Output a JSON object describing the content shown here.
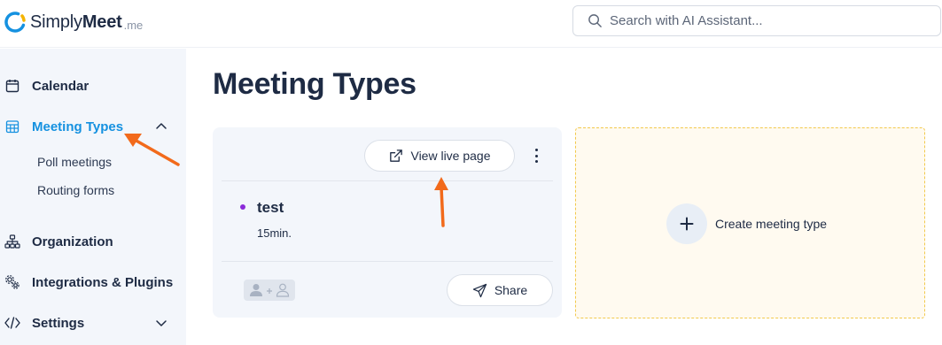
{
  "app": {
    "logo_simply": "Simply",
    "logo_meet": "Meet",
    "logo_tld": ".me",
    "brand_color": "#1591e0"
  },
  "search": {
    "placeholder": "Search with AI Assistant..."
  },
  "sidebar": {
    "items": [
      {
        "label": "Calendar",
        "icon": "calendar-icon"
      },
      {
        "label": "Meeting Types",
        "icon": "grid-calendar-icon",
        "active": true,
        "expanded": true
      },
      {
        "label": "Organization",
        "icon": "org-chart-icon"
      },
      {
        "label": "Integrations & Plugins",
        "icon": "gears-icon"
      },
      {
        "label": "Settings",
        "icon": "code-icon"
      }
    ],
    "sub_items": [
      "Poll meetings",
      "Routing forms"
    ]
  },
  "main": {
    "title": "Meeting Types",
    "meeting_card": {
      "view_live_label": "View live page",
      "name": "test",
      "duration": "15min.",
      "share_label": "Share",
      "dot_color": "#8b2bd9"
    },
    "create_card": {
      "label": "Create meeting type"
    }
  },
  "annotation_color": "#f26a1b"
}
